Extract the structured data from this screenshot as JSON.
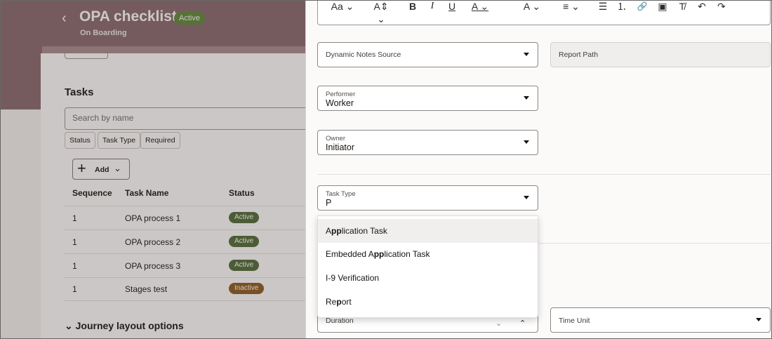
{
  "app": {
    "title": "OPA checklist",
    "status_badge": "Active",
    "subtitle": "On Boarding",
    "back_glyph": "‹"
  },
  "tasks": {
    "title": "Tasks",
    "search_placeholder": "Search by name",
    "filters": [
      "Status",
      "Task Type",
      "Required"
    ],
    "add_button": {
      "icon": "+",
      "label": "Add",
      "caret": "⌄"
    },
    "columns": [
      "Sequence",
      "Task Name",
      "Status"
    ],
    "rows": [
      {
        "sequence": "1",
        "name": "OPA process 1",
        "status": "Active"
      },
      {
        "sequence": "1",
        "name": "OPA process 2",
        "status": "Active"
      },
      {
        "sequence": "1",
        "name": "OPA process 3",
        "status": "Active"
      },
      {
        "sequence": "1",
        "name": "Stages test",
        "status": "Inactive"
      }
    ]
  },
  "journey_section": {
    "caret": "⌄",
    "title": "Journey layout options"
  },
  "toolbar": {
    "items": [
      {
        "name": "font-size-icon",
        "glyph": "Aa ⌄"
      },
      {
        "name": "text-size-icon",
        "glyph": "A⇕ ⌄"
      },
      {
        "name": "bold-icon",
        "glyph": "B"
      },
      {
        "name": "italic-icon",
        "glyph": "I"
      },
      {
        "name": "underline-icon",
        "glyph": "U"
      },
      {
        "name": "font-color-icon",
        "glyph": "A ⌄"
      },
      {
        "name": "highlight-color-icon",
        "glyph": "A ⌄"
      },
      {
        "name": "align-icon",
        "glyph": "≡ ⌄"
      },
      {
        "name": "bulleted-list-icon",
        "glyph": "☰"
      },
      {
        "name": "numbered-list-icon",
        "glyph": "⒈"
      },
      {
        "name": "link-icon",
        "glyph": "🔗"
      },
      {
        "name": "media-icon",
        "glyph": "▣"
      },
      {
        "name": "clear-format-icon",
        "glyph": "T̸"
      },
      {
        "name": "undo-icon",
        "glyph": "↶"
      },
      {
        "name": "redo-icon",
        "glyph": "↷"
      }
    ]
  },
  "form": {
    "dynamic_notes_source": {
      "placeholder": "Dynamic Notes Source"
    },
    "report_path": {
      "placeholder": "Report Path"
    },
    "performer": {
      "label": "Performer",
      "value": "Worker"
    },
    "owner": {
      "label": "Owner",
      "value": "Initiator"
    },
    "task_type": {
      "label": "Task Type",
      "value": "P"
    },
    "duration": {
      "placeholder": "Duration"
    },
    "time_unit": {
      "placeholder": "Time Unit"
    }
  },
  "task_type_options": [
    {
      "pre": "A",
      "match": "pp",
      "post": "lication Task"
    },
    {
      "pre": "Embedded A",
      "match": "pp",
      "post": "lication Task"
    },
    {
      "pre": "I-9 Verification",
      "match": "",
      "post": ""
    },
    {
      "pre": "Re",
      "match": "p",
      "post": "ort"
    }
  ],
  "colors": {
    "header": "#8a6a6f",
    "active_badge": "#4f6b36",
    "inactive_badge": "#8c5a1f"
  }
}
